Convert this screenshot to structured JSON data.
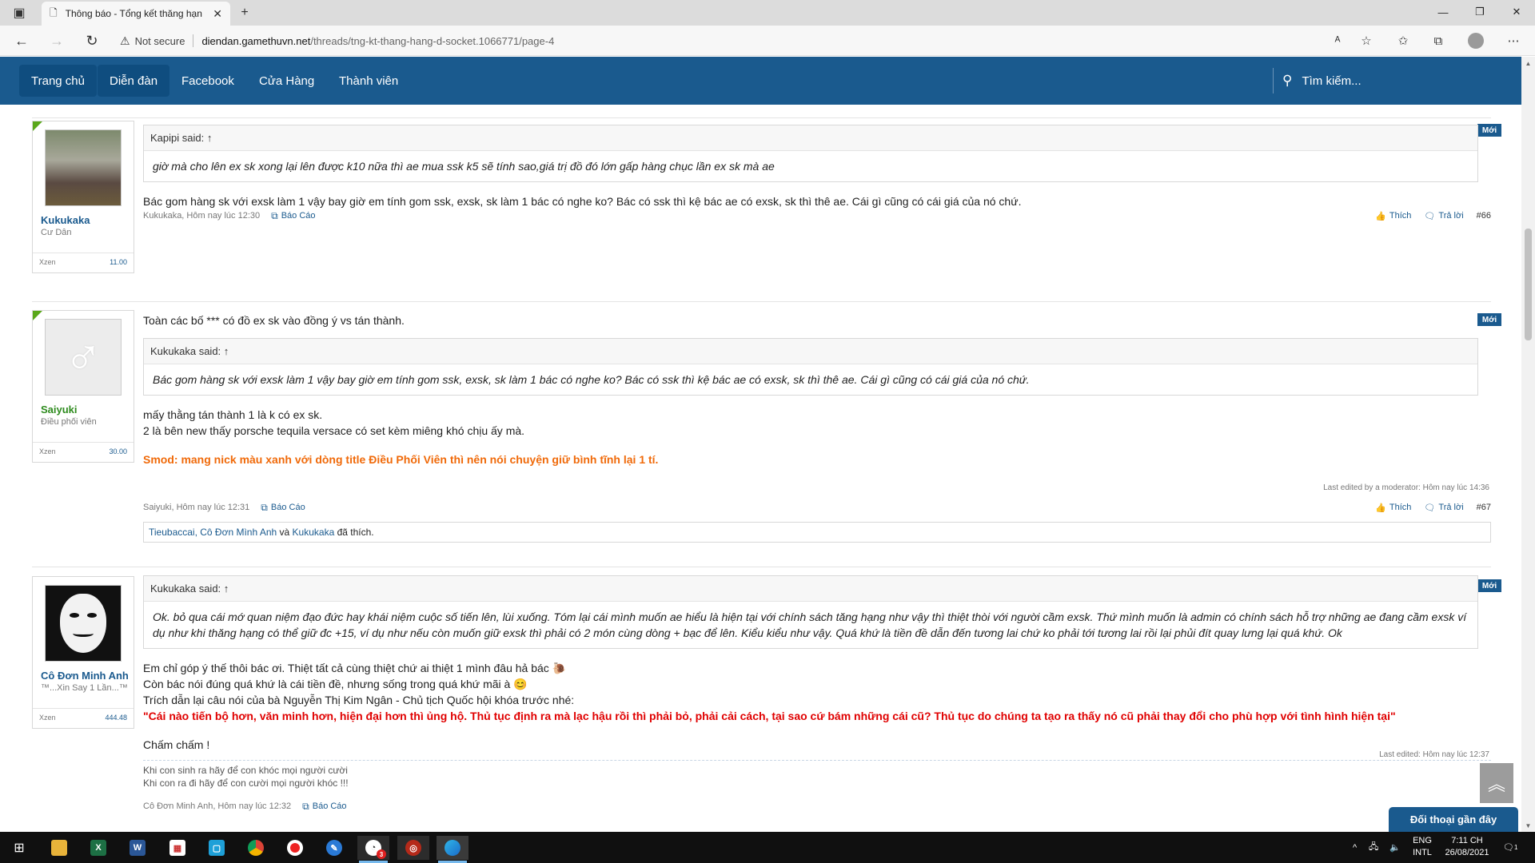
{
  "browser": {
    "tab_title": "Thông báo - Tổng kết thăng hạn",
    "security": "Not secure",
    "url_host": "diendan.gamethuvn.net",
    "url_path": "/threads/tng-kt-thang-hang-d-socket.1066771/page-4"
  },
  "nav": {
    "items": [
      {
        "label": "Trang chủ"
      },
      {
        "label": "Diễn đàn"
      },
      {
        "label": "Facebook"
      },
      {
        "label": "Cửa Hàng"
      },
      {
        "label": "Thành viên"
      }
    ],
    "search_label": "Tìm kiếm..."
  },
  "posts": [
    {
      "user": {
        "name": "Kukukaka",
        "title": "Cư Dân",
        "stat_label": "Xzen",
        "stat_value": "11.00"
      },
      "badge": "Mới",
      "quote": {
        "author": "Kapipi said: ↑",
        "text": "giờ mà cho lên ex sk xong lại lên được k10 nữa thì ae mua ssk k5 sẽ tính sao,giá trị đồ đó lớn gấp hàng chục lần ex sk mà ae"
      },
      "body": "Bác gom hàng sk với exsk làm 1 vậy bay giờ em tính gom ssk, exsk, sk làm 1 bác có nghe ko? Bác có ssk thì kệ bác ae có exsk, sk thì thê ae. Cái gì cũng có cái giá của nó chứ.",
      "meta": {
        "author_time": "Kukukaka, Hôm nay lúc 12:30",
        "report": "Báo Cáo",
        "like": "Thích",
        "reply": "Trả lời",
        "num": "#66"
      }
    },
    {
      "user": {
        "name": "Saiyuki",
        "title": "Điều phối viên",
        "stat_label": "Xzen",
        "stat_value": "30.00"
      },
      "badge": "Mới",
      "intro": "Toàn các bố *** có đồ ex sk vào đồng ý vs tán thành.",
      "quote": {
        "author": "Kukukaka said: ↑",
        "text": "Bác gom hàng sk với exsk làm 1 vậy bay giờ em tính gom ssk, exsk, sk làm 1 bác có nghe ko? Bác có ssk thì kệ bác ae có exsk, sk thì thê ae. Cái gì cũng có cái giá của nó chứ."
      },
      "body1": "mấy thằng tán thành 1 là k có ex sk.",
      "body2": "2 là bên new thấy porsche tequila versace có set kèm miêng khó chịu ấy mà.",
      "smod": "Smod: mang nick màu xanh với dòng title Điều Phối Viên thì nên nói chuyện giữ bình tĩnh lại 1 tí.",
      "edited": "Last edited by a moderator: Hôm nay lúc 14:36",
      "meta": {
        "author_time": "Saiyuki, Hôm nay lúc 12:31",
        "report": "Báo Cáo",
        "like": "Thích",
        "reply": "Trả lời",
        "num": "#67"
      },
      "likes": {
        "users": "Tieubaccai, Cô Đơn Mình Anh",
        "and": "và",
        "last": "Kukukaka",
        "suffix": "đã thích."
      }
    },
    {
      "user": {
        "name": "Cô Đơn Minh Anh",
        "title": "™...Xin Say 1 Lần...™",
        "stat_label": "Xzen",
        "stat_value": "444.48"
      },
      "badge": "Mới",
      "quote": {
        "author": "Kukukaka said: ↑",
        "text": "Ok. bỏ qua cái mớ quan niệm đạo đức hay khái niệm cuộc số tiến lên, lùi xuống. Tóm lại cái mình muốn ae hiểu là hiện tại với chính sách tăng hạng như vậy thì thiệt thòi với người cầm exsk. Thứ mình muốn là admin có chính sách hỗ trợ những ae đang cầm exsk ví dụ như khi thăng hạng có thể giữ đc +15, ví dụ như nếu còn muốn giữ exsk thì phải có 2 món cùng dòng + bạc để lên. Kiểu kiểu như vậy. Quá khứ là tiền đề dẫn đến tương lai chứ ko phải tới tương lai rồi lại phủi đít quay lưng lại quá khứ. Ok"
      },
      "line1": "Em chỉ góp ý thế thôi bác ơi. Thiệt tất cả cùng thiệt chứ ai thiệt 1 mình đâu hả bác",
      "line2": "Còn bác nói đúng quá khứ là cái tiền đề, nhưng sống trong quá khứ mãi à",
      "line3": "Trích dẫn lại câu nói của bà Nguyễn Thị Kim Ngân - Chủ tịch Quốc hội khóa trước nhé:",
      "red": "\"Cái nào tiến bộ hơn, văn minh hơn, hiện đại hơn thì ủng hộ. Thủ tục định ra mà lạc hậu rồi thì phải bỏ, phải cải cách, tại sao cứ bám những cái cũ? Thủ tục do chúng ta tạo ra thấy nó cũ phải thay đổi cho phù hợp với tình hình hiện tại\"",
      "closing": "Chấm chấm !",
      "edited": "Last edited: Hôm nay lúc 12:37",
      "sig1": "Khi con sinh ra hãy để con khóc mọi người cười",
      "sig2": "Khi con ra đi hãy để con cười mọi người khóc !!!",
      "meta": {
        "author_time": "Cô Đơn Minh Anh, Hôm nay lúc 12:32",
        "report": "Báo Cáo"
      }
    }
  ],
  "widgets": {
    "recent_chat": "Đối thoại gần đây"
  },
  "taskbar": {
    "lang1": "ENG",
    "lang2": "INTL",
    "time": "7:11 CH",
    "date": "26/08/2021",
    "badge": "3",
    "notif": "1"
  },
  "colors": {
    "brand": "#1a5a8e",
    "orange": "#f06a0a",
    "red": "#e00000",
    "green": "#5aa71a"
  }
}
